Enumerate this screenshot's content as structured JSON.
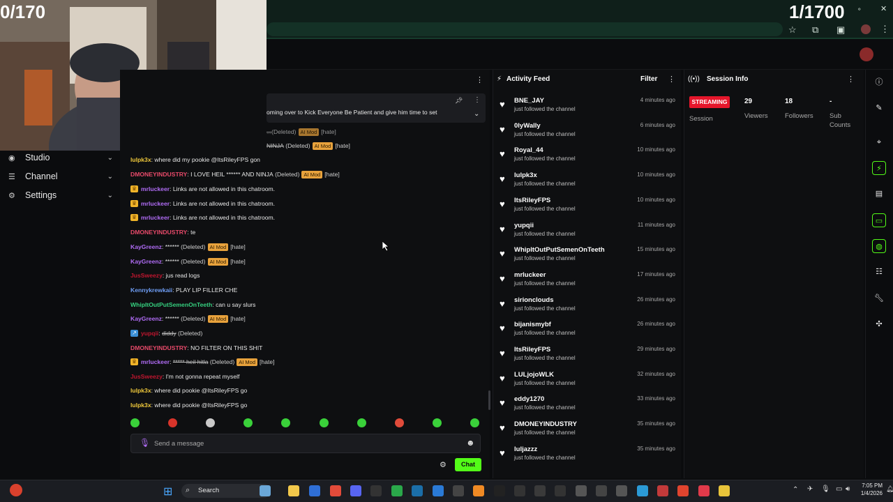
{
  "overlay": {
    "left_counter": "0/170",
    "right_counter": "1/1700"
  },
  "sidebar": {
    "items": [
      {
        "label": "Studio",
        "icon": "studio-icon"
      },
      {
        "label": "Channel",
        "icon": "channel-icon"
      },
      {
        "label": "Settings",
        "icon": "gear-icon"
      }
    ]
  },
  "chat": {
    "pinned_text": "oming over to Kick Everyone Be Patient and give him time to set",
    "mod_badge": "AI Mod",
    "hate_tag": "[hate]",
    "deleted_tag": "(Deleted)",
    "messages": [
      {
        "user": "",
        "text": "",
        "partial": "NINJA",
        "deleted": true
      },
      {
        "user": "lulpk3x",
        "color": "#f0c93b",
        "text": "where did my pookie @ItsRileyFPS gon"
      },
      {
        "user": "DMONEYINDUSTRY",
        "color": "#e84a6a",
        "text": "I LOVE HEIL ****** AND NINJA",
        "deleted": true,
        "mod": true
      },
      {
        "user": "mrluckeer",
        "color": "#b06cf5",
        "text": "Links are not allowed in this chatroom.",
        "crown": true
      },
      {
        "user": "mrluckeer",
        "color": "#b06cf5",
        "text": "Links are not allowed in this chatroom.",
        "crown": true
      },
      {
        "user": "mrluckeer",
        "color": "#b06cf5",
        "text": "Links are not allowed in this chatroom.",
        "crown": true
      },
      {
        "user": "DMONEYINDUSTRY",
        "color": "#e84a6a",
        "text": "te"
      },
      {
        "user": "KayGreenz",
        "color": "#b06cf5",
        "text": "******",
        "deleted": true,
        "mod": true
      },
      {
        "user": "KayGreenz",
        "color": "#b06cf5",
        "text": "******",
        "deleted": true,
        "mod": true
      },
      {
        "user": "JusSweezy",
        "color": "#c0162f",
        "text": "jus read logs"
      },
      {
        "user": "Kennykrewkaii",
        "color": "#6f9ef5",
        "text": "PLAY LIP FILLER CHE"
      },
      {
        "user": "WhipItOutPutSemenOnTeeth",
        "color": "#35d07f",
        "text": "can u say slurs"
      },
      {
        "user": "KayGreenz",
        "color": "#b06cf5",
        "text": "******",
        "deleted": true,
        "mod": true
      },
      {
        "user": "yupqii",
        "color": "#c0162f",
        "text": "diddy",
        "deleted": true,
        "strike": true,
        "blueicon": true
      },
      {
        "user": "DMONEYINDUSTRY",
        "color": "#e84a6a",
        "text": "NO FILTER ON THIS SHIT"
      },
      {
        "user": "mrluckeer",
        "color": "#b06cf5",
        "text": "***** heil hitla",
        "deleted": true,
        "mod": true,
        "crown": true,
        "strike": true
      },
      {
        "user": "JusSweezy",
        "color": "#c0162f",
        "text": "I'm not gonna repeat myself"
      },
      {
        "user": "lulpk3x",
        "color": "#f0c93b",
        "text": "where did pookie @ItsRileyFPS go"
      },
      {
        "user": "lulpk3x",
        "color": "#f0c93b",
        "text": "where did pookie @ItsRileyFPS go"
      }
    ],
    "input_placeholder": "Send a message",
    "send_label": "Chat"
  },
  "activity_feed": {
    "title": "Activity Feed",
    "filter_label": "Filter",
    "event_text": "just followed the channel",
    "items": [
      {
        "name": "BNE_JAY",
        "time": "4 minutes ago"
      },
      {
        "name": "0lyWally",
        "time": "6 minutes ago"
      },
      {
        "name": "Royal_44",
        "time": "10 minutes ago"
      },
      {
        "name": "lulpk3x",
        "time": "10 minutes ago"
      },
      {
        "name": "ItsRileyFPS",
        "time": "10 minutes ago"
      },
      {
        "name": "yupqii",
        "time": "11 minutes ago"
      },
      {
        "name": "WhipItOutPutSemenOnTeeth",
        "time": "15 minutes ago"
      },
      {
        "name": "mrluckeer",
        "time": "17 minutes ago"
      },
      {
        "name": "sirionclouds",
        "time": "26 minutes ago"
      },
      {
        "name": "bijanismybf",
        "time": "26 minutes ago"
      },
      {
        "name": "ItsRileyFPS",
        "time": "29 minutes ago"
      },
      {
        "name": "LULjojoWLK",
        "time": "32 minutes ago"
      },
      {
        "name": "eddy1270",
        "time": "33 minutes ago"
      },
      {
        "name": "DMONEYINDUSTRY",
        "time": "35 minutes ago"
      },
      {
        "name": "luljazzz",
        "time": "35 minutes ago"
      }
    ]
  },
  "session": {
    "title": "Session Info",
    "status": "STREAMING",
    "session_label": "Session",
    "viewers": "29",
    "viewers_label": "Viewers",
    "followers": "18",
    "followers_label": "Followers",
    "subs": "-",
    "subs_label": "Sub Counts"
  },
  "taskbar": {
    "search_label": "Search",
    "time": "7:05 PM",
    "date": "1/4/2026"
  },
  "colors": {
    "kick_green": "#53fc18",
    "streaming_red": "#e5162b",
    "mod_badge": "#e8a23c"
  }
}
